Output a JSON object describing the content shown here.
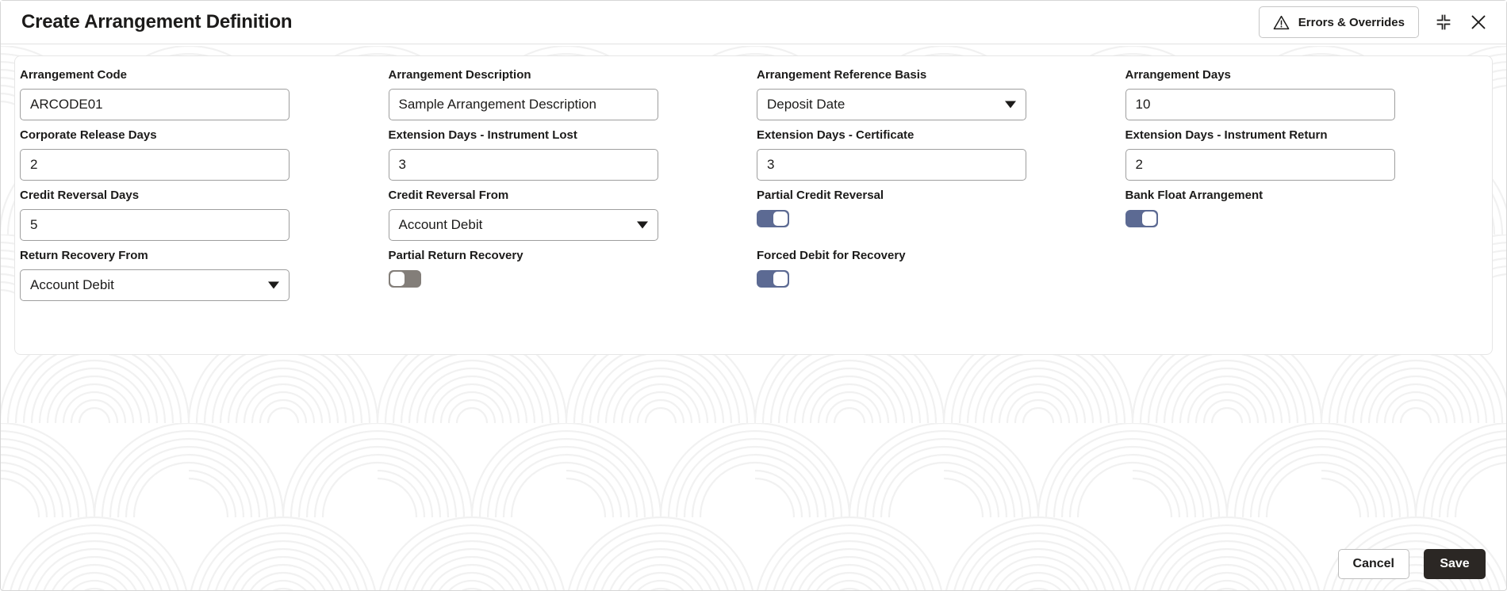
{
  "header": {
    "title": "Create Arrangement Definition",
    "errors_button": "Errors & Overrides",
    "warning_icon": "warning-triangle-icon",
    "collapse_icon": "collapse-icon",
    "close_icon": "close-icon"
  },
  "form": {
    "rows": [
      [
        {
          "label": "Arrangement Code",
          "type": "text",
          "value": "ARCODE01"
        },
        {
          "label": "Arrangement Description",
          "type": "text",
          "value": "Sample Arrangement Description"
        },
        {
          "label": "Arrangement Reference Basis",
          "type": "select",
          "value": "Deposit Date"
        },
        {
          "label": "Arrangement Days",
          "type": "text",
          "value": "10"
        }
      ],
      [
        {
          "label": "Corporate Release Days",
          "type": "text",
          "value": "2"
        },
        {
          "label": "Extension Days - Instrument Lost",
          "type": "text",
          "value": "3"
        },
        {
          "label": "Extension Days - Certificate",
          "type": "text",
          "value": "3"
        },
        {
          "label": "Extension Days - Instrument Return",
          "type": "text",
          "value": "2"
        }
      ],
      [
        {
          "label": "Credit Reversal Days",
          "type": "text",
          "value": "5"
        },
        {
          "label": "Credit Reversal From",
          "type": "select",
          "value": "Account Debit"
        },
        {
          "label": "Partial Credit Reversal",
          "type": "toggle",
          "value": "on"
        },
        {
          "label": "Bank Float Arrangement",
          "type": "toggle",
          "value": "on"
        }
      ],
      [
        {
          "label": "Return Recovery From",
          "type": "select",
          "value": "Account Debit"
        },
        {
          "label": "Partial Return Recovery",
          "type": "toggle",
          "value": "off"
        },
        {
          "label": "Forced Debit for Recovery",
          "type": "toggle",
          "value": "on"
        },
        {
          "label": "",
          "type": "empty",
          "value": ""
        }
      ]
    ]
  },
  "footer": {
    "cancel_label": "Cancel",
    "save_label": "Save"
  },
  "colors": {
    "toggle_on": "#5c6a93",
    "toggle_off": "#837e79",
    "save_bg": "#2b2724",
    "text": "#1c1b1a",
    "border": "#9e9e9e"
  }
}
